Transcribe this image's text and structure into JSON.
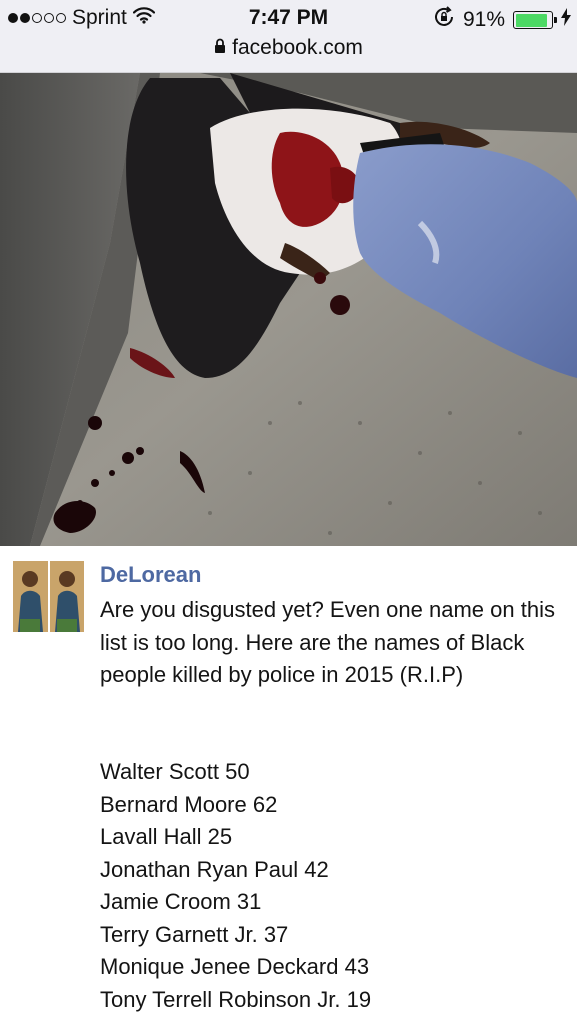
{
  "status_bar": {
    "carrier": "Sprint",
    "time": "7:47 PM",
    "battery": "91%",
    "battery_level": 0.91,
    "url": "facebook.com"
  },
  "post": {
    "author": "DeLorean",
    "intro": "Are you disgusted yet? Even one name on this list is too long. Here are the names of Black people killed by police in 2015 (R.I.P)",
    "names": [
      "Walter Scott 50",
      "Bernard Moore 62",
      "Lavall Hall 25",
      "Jonathan Ryan Paul 42",
      "Jamie Croom 31",
      "Terry Garnett Jr. 37",
      "Monique Jenee Deckard 43",
      "Tony Terrell Robinson Jr. 19"
    ]
  },
  "icons": {
    "wifi": "wifi-icon",
    "lock": "lock-icon",
    "rotation_lock": "rotation-lock-icon",
    "charging": "charging-bolt-icon"
  }
}
